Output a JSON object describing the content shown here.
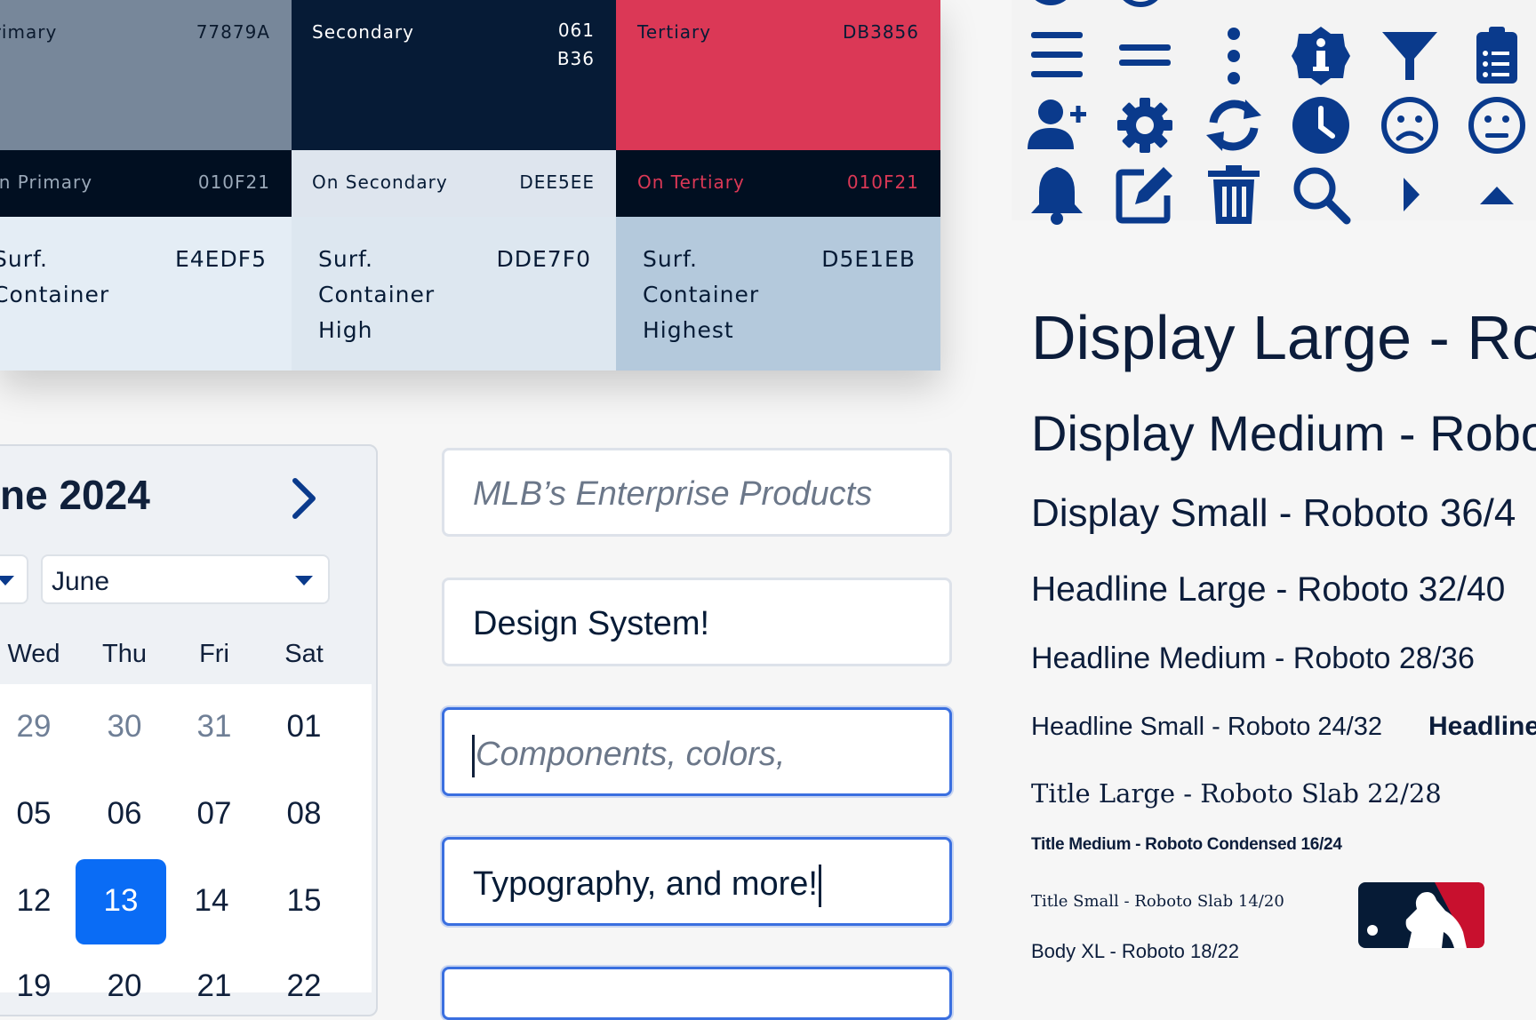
{
  "swatches": {
    "primary": {
      "label": "Primary",
      "hex": "77879A",
      "bg": "#77879A",
      "fg": "#0b1a2e"
    },
    "secondary": {
      "label": "Secondary",
      "hex1": "061",
      "hex2": "B36",
      "bg": "#061B36",
      "fg": "#ffffff"
    },
    "tertiary": {
      "label": "Tertiary",
      "hex": "DB3856",
      "bg": "#DB3856",
      "fg": "#061B36"
    },
    "on_primary": {
      "label": "On Primary",
      "hex": "010F21",
      "bg": "#010F21",
      "fg": "#9aa8b8"
    },
    "on_secondary": {
      "label": "On Secondary",
      "hex": "DEE5EE",
      "bg": "#DEE5EE",
      "fg": "#061B36"
    },
    "on_tertiary": {
      "label": "On Tertiary",
      "hex": "010F21",
      "bg": "#010F21",
      "fg": "#DB3856"
    },
    "surf_container": {
      "l1": "Surf.",
      "l2": "Container",
      "hex": "E4EDF5",
      "bg": "#E4EDF5"
    },
    "surf_container_high": {
      "l1": "Surf.",
      "l2": "Container",
      "l3": "High",
      "hex": "DDE7F0",
      "bg": "#DDE7F0"
    },
    "surf_container_highest": {
      "l1": "Surf.",
      "l2": "Container",
      "l3": "Highest",
      "hex": "D5E1EB",
      "bg": "#B4C9DC"
    }
  },
  "calendar": {
    "title": "ne 2024",
    "month_select": "June",
    "weekdays": [
      "Wed",
      "Thu",
      "Fri",
      "Sat"
    ],
    "rows": [
      [
        "29",
        "30",
        "31",
        "01"
      ],
      [
        "05",
        "06",
        "07",
        "08"
      ],
      [
        "12",
        "13",
        "14",
        "15"
      ],
      [
        "19",
        "20",
        "21",
        "22"
      ]
    ],
    "selected_day": "13"
  },
  "inputs": {
    "field1": "MLB’s Enterprise Products",
    "field2": "Design System!",
    "field3": "Components, colors,",
    "field4": "Typography, and more!"
  },
  "icons": [
    "menu-icon",
    "drag-handle-icon",
    "more-vert-icon",
    "info-icon",
    "filter-icon",
    "clipboard-list-icon",
    "person-add-icon",
    "settings-icon",
    "refresh-icon",
    "clock-icon",
    "sad-face-icon",
    "neutral-face-icon",
    "bell-icon",
    "edit-icon",
    "trash-icon",
    "search-icon",
    "arrow-right-icon",
    "arrow-up-icon"
  ],
  "accent": "#0a3a8c",
  "typography": {
    "display_large": "Display Large - Ro",
    "display_medium": "Display Medium - Robo",
    "display_small": "Display Small - Roboto 36/4",
    "headline_large": "Headline Large - Roboto 32/40",
    "headline_medium": "Headline Medium - Roboto 28/36",
    "headline_small": "Headline Small - Roboto 24/32",
    "headline_bold": "Headline",
    "title_large": "Title Large - Roboto Slab 22/28",
    "title_medium": "Title Medium - Roboto Condensed 16/24",
    "title_small": "Title Small - Roboto Slab 14/20",
    "body_xl": "Body XL - Roboto 18/22"
  }
}
